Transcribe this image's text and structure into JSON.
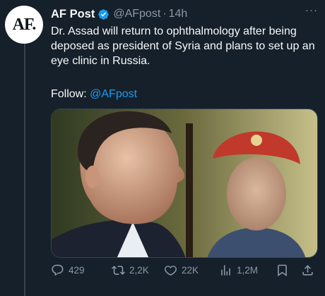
{
  "tweet": {
    "avatar_text": "AF.",
    "author_name": "AF Post",
    "handle": "@AFpost",
    "separator": "·",
    "time": "14h",
    "text": "Dr. Assad will return to ophthalmology after being deposed as president of Syria and plans to set up an eye clinic in Russia.",
    "follow_label": "Follow:",
    "follow_link": "@AFpost",
    "more_label": "···"
  },
  "actions": {
    "replies": "429",
    "reposts": "2,2K",
    "likes": "22K",
    "views": "1,2M"
  },
  "icons": {
    "verified": "verified-badge-icon",
    "reply": "reply-icon",
    "repost": "repost-icon",
    "like": "heart-icon",
    "views": "views-icon",
    "bookmark": "bookmark-icon",
    "share": "share-icon"
  },
  "colors": {
    "background": "#15202b",
    "accent": "#1d9bf0",
    "muted": "#8b98a5"
  }
}
